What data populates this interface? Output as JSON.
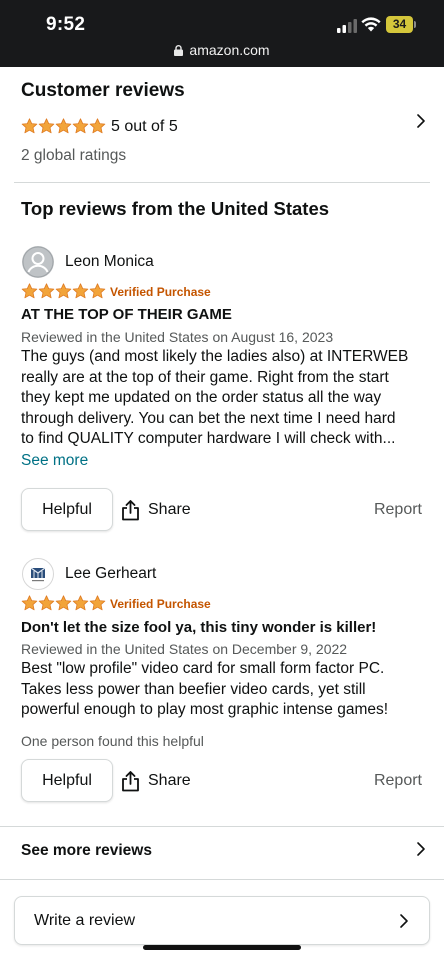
{
  "status_bar": {
    "time": "9:52",
    "battery": "34",
    "url": "amazon.com"
  },
  "summary": {
    "heading": "Customer reviews",
    "rating": 5,
    "rating_text": "5 out of 5",
    "ratings_count": "2 global ratings"
  },
  "top_reviews_heading": "Top reviews from the United States",
  "reviews": [
    {
      "name": "Leon Monica",
      "rating": 5,
      "verified": "Verified Purchase",
      "title": "AT THE TOP OF THEIR GAME",
      "meta": "Reviewed in the United States on August 16, 2023",
      "body_lines": [
        "The guys (and most likely the ladies also) at INTERWEB",
        "really are at the top of their game. Right from the start",
        "they kept me updated on the order status all the way",
        "through delivery. You can bet the next time I need hard",
        "to find QUALITY computer hardware I will check with..."
      ],
      "see_more": "See more",
      "helpful_label": "Helpful",
      "share_label": "Share",
      "report_label": "Report"
    },
    {
      "name": "Lee Gerheart",
      "rating": 5,
      "verified": "Verified Purchase",
      "title": "Don't let the size fool ya, this tiny wonder is killer!",
      "meta": "Reviewed in the United States on December 9, 2022",
      "body_lines": [
        "Best \"low profile\" video card for small form factor PC.",
        "Takes less power than beefier video cards, yet still",
        "powerful enough to play most graphic intense games!"
      ],
      "helpful_count": "One person found this helpful",
      "helpful_label": "Helpful",
      "share_label": "Share",
      "report_label": "Report"
    }
  ],
  "see_more_reviews": "See more reviews",
  "write_review": "Write a review",
  "colors": {
    "star": "#f2a43a",
    "verified": "#c45500",
    "link": "#007185",
    "status_bar": "#18191b"
  }
}
